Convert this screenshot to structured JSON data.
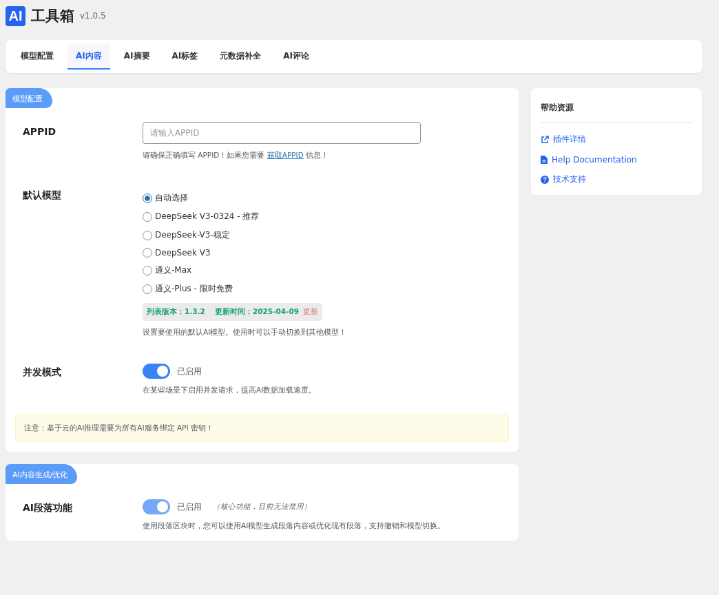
{
  "header": {
    "logo": "AI",
    "title": "工具箱",
    "version": "v1.0.5"
  },
  "tabs": [
    {
      "label": "模型配置",
      "selected": false
    },
    {
      "label": "AI内容",
      "selected": true
    },
    {
      "label": "AI摘要",
      "selected": false
    },
    {
      "label": "AI标签",
      "selected": false
    },
    {
      "label": "元数据补全",
      "selected": false
    },
    {
      "label": "AI评论",
      "selected": false
    }
  ],
  "sections": [
    {
      "badge": "模型配置",
      "rows": [
        {
          "kind": "text_field",
          "label": "APPID",
          "placeholder": "请输入APPID",
          "help": "请确保正确填写 APPID！如果您需要 ",
          "link": "获取APPID",
          "help_after": " 信息！"
        },
        {
          "kind": "radio_group",
          "label": "默认模型",
          "options": [
            {
              "label": "自动选择",
              "selected": true
            },
            {
              "label": "DeepSeek V3-0324 - 推荐",
              "selected": false
            },
            {
              "label": "DeepSeek-V3-稳定",
              "selected": false
            },
            {
              "label": "DeepSeek V3",
              "selected": false
            },
            {
              "label": "通义-Max",
              "selected": false
            },
            {
              "label": "通义-Plus - 限时免费",
              "selected": false
            }
          ],
          "version_info": {
            "version": "列表版本：1.3.2",
            "updated": "更新时间：2025-04-09",
            "action": "更新"
          },
          "help": "设置要使用的默认AI模型。使用时可以手动切换到其他模型！"
        },
        {
          "kind": "toggle",
          "label": "并发模式",
          "on": true,
          "disabled": false,
          "state_text": "已启用",
          "help": "在某些场景下启用并发请求，提高AI数据加载速度。"
        }
      ],
      "notice": "注意：基于云的AI推理需要为所有AI服务绑定 API 密钥！"
    },
    {
      "badge": "AI内容生成/优化",
      "rows": [
        {
          "kind": "toggle",
          "label": "AI段落功能",
          "on": true,
          "disabled": true,
          "state_text": "已启用",
          "note": "（核心功能，目前无法禁用）",
          "help": "使用段落区块时，您可以使用AI模型生成段落内容或优化现有段落，支持撤销和模型切换。"
        }
      ]
    }
  ],
  "sidebar": {
    "title": "帮助资源",
    "links": [
      {
        "kind": "external",
        "label": "插件详情"
      },
      {
        "kind": "document",
        "label": "Help Documentation"
      },
      {
        "kind": "help",
        "label": "技术支持"
      }
    ]
  }
}
